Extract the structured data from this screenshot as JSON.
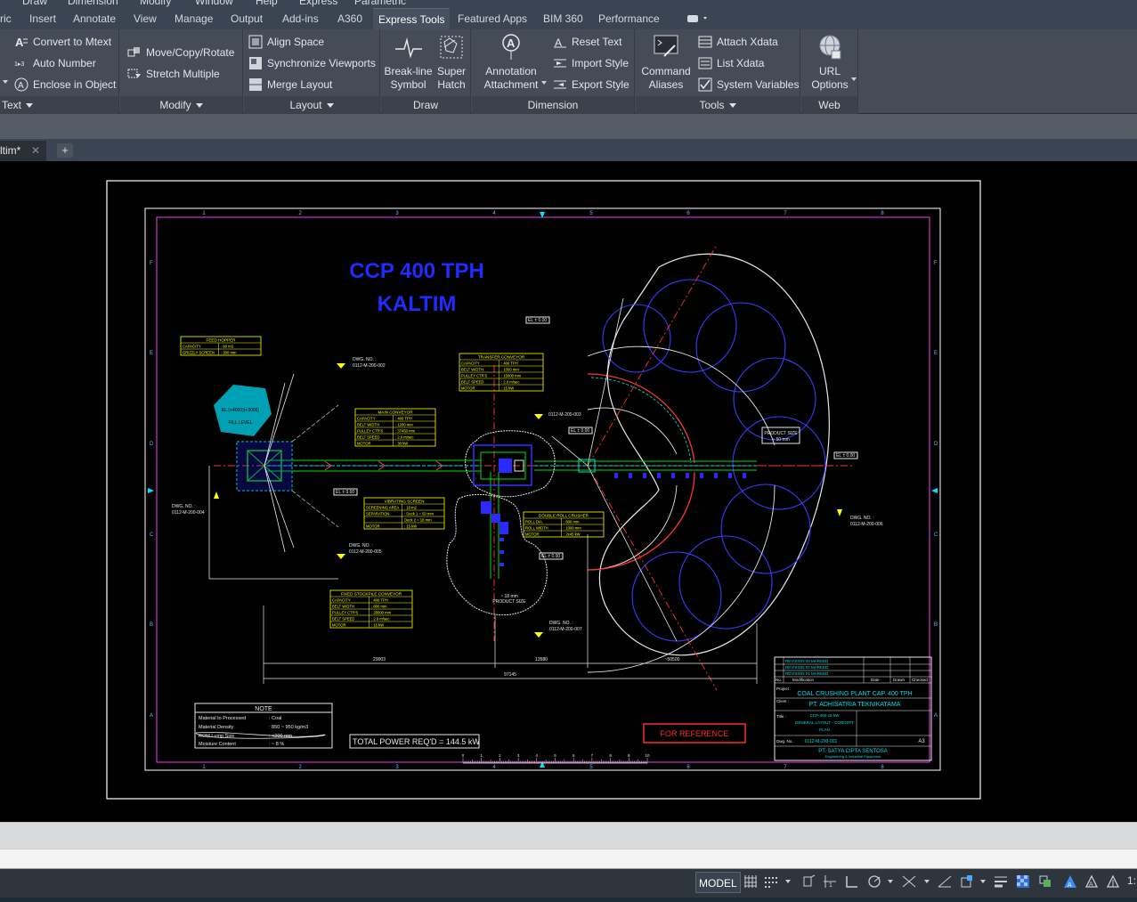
{
  "menubar": {
    "items": [
      "Draw",
      "Dimension",
      "Modify",
      "Window",
      "Help",
      "Express",
      "Parametric"
    ]
  },
  "ribbon_tabs": [
    {
      "label": "ric"
    },
    {
      "label": "Insert"
    },
    {
      "label": "Annotate"
    },
    {
      "label": "View"
    },
    {
      "label": "Manage"
    },
    {
      "label": "Output"
    },
    {
      "label": "Add-ins"
    },
    {
      "label": "A360"
    },
    {
      "label": "Express Tools",
      "active": true
    },
    {
      "label": "Featured Apps"
    },
    {
      "label": "BIM 360"
    },
    {
      "label": "Performance"
    }
  ],
  "ribbon": {
    "text_panel": {
      "title": "Text",
      "buttons": [
        "Convert to Mtext",
        "Auto Number",
        "Enclose in Object"
      ]
    },
    "modify_panel": {
      "title": "Modify",
      "buttons": [
        "Move/Copy/Rotate",
        "Stretch Multiple"
      ]
    },
    "layout_panel": {
      "title": "Layout",
      "buttons": [
        "Align Space",
        "Synchronize Viewports",
        "Merge Layout"
      ]
    },
    "draw_panel": {
      "title": "Draw",
      "large_buttons": [
        {
          "line1": "Break-line",
          "line2": "Symbol"
        },
        {
          "line1": "Super",
          "line2": "Hatch"
        }
      ]
    },
    "dimension_panel": {
      "title": "Dimension",
      "large_button": {
        "line1": "Annotation",
        "line2": "Attachment"
      },
      "buttons": [
        "Reset Text",
        "Import Style",
        "Export Style"
      ]
    },
    "tools_panel": {
      "title": "Tools",
      "large_button": {
        "line1": "Command",
        "line2": "Aliases"
      },
      "buttons": [
        "Attach Xdata",
        "List Xdata",
        "System Variables"
      ]
    },
    "web_panel": {
      "title": "Web",
      "large_button": {
        "line1": "URL",
        "line2": "Options"
      }
    }
  },
  "file_tab": {
    "label": "ltim*",
    "close": "✕",
    "plus": "+"
  },
  "drawing": {
    "title_line1": "CCP 400 TPH",
    "title_line2": "KALTIM",
    "feed_hopper": {
      "title": "FEED HOPPER",
      "rows": [
        [
          "CAPACITY",
          ": 60 m3"
        ],
        [
          "GRIZZLY SCREEN",
          ": 300 mm"
        ]
      ]
    },
    "main_conveyor": {
      "title": "MAIN CONVEYOR",
      "rows": [
        [
          "CAPACITY",
          ": 400 TPH"
        ],
        [
          "BELT WIDTH",
          ": 1200 mm"
        ],
        [
          "PULLEY CTR'S",
          ": 37450 mm"
        ],
        [
          "BELT SPEED",
          ": 2.0 m/sec"
        ],
        [
          "MOTOR",
          ": 30 kW"
        ]
      ]
    },
    "transfer_conveyor": {
      "title": "TRANSFER CONVEYOR",
      "rows": [
        [
          "CAPACITY",
          ": 400 TPH"
        ],
        [
          "BELT WIDTH",
          ": 1000 mm"
        ],
        [
          "PULLEY CTR'S",
          ": 15000 mm"
        ],
        [
          "BELT SPEED",
          ": 2.0 m/sec"
        ],
        [
          "MOTOR",
          ": 15 kW"
        ]
      ]
    },
    "vibrating_screen": {
      "title": "VIBRATING SCREEN",
      "rows": [
        [
          "SCREENING AREA",
          ": 10 m2"
        ],
        [
          "SEPARATION",
          ": Deck 1 = 50 mm"
        ],
        [
          "",
          "  Deck 2 = 18 mm"
        ],
        [
          "MOTOR",
          ": 15 kW"
        ]
      ]
    },
    "double_roll_crusher": {
      "title": "DOUBLE ROLL CRUSHER",
      "rows": [
        [
          "ROLL DIA.",
          ": 800 mm"
        ],
        [
          "ROLL WIDTH",
          ": 1000 mm"
        ],
        [
          "MOTOR",
          ": 2x45 kW"
        ]
      ]
    },
    "fixed_stockpile_conveyor": {
      "title": "FIXED STOCKPILE CONVEYOR",
      "rows": [
        [
          "CAPACITY",
          ": 400 TPH"
        ],
        [
          "BELT WIDTH",
          ": 800 mm"
        ],
        [
          "PULLEY CTR'S",
          ": 28000 mm"
        ],
        [
          "BELT SPEED",
          ": 2.0 m/sec"
        ],
        [
          "MOTOR",
          ": 15 kW"
        ]
      ]
    },
    "note": {
      "title": "NOTE",
      "rows": [
        [
          "Material to Processed",
          ":  Coal"
        ],
        [
          "Material Density",
          ":  850 ~ 950 kg/m3"
        ],
        [
          "ROM Lump Size",
          ":  <200 mm"
        ],
        [
          "Moisture Content",
          ":  ~ 8 %"
        ]
      ]
    },
    "total_power": "TOTAL POWER REQ'D = 144.5 kW",
    "for_reference": "FOR REFERENCE",
    "product_size_1": "PRODUCT SIZE",
    "product_size_1b": "~ 50 mm",
    "product_size_2": "~ 18 mm",
    "product_size_2b": "PRODUCT SIZE",
    "el_labels": [
      "EL ± 0.00",
      "EL ± 0.00",
      "EL ± 0.00",
      "EL ± 0.00",
      "EL ± 0.00"
    ],
    "fill_level": "FILL LEVEL",
    "fill_el": "EL.(+4000)(+3000)",
    "dwg_refs": [
      "DWG. NO. :",
      "0112-M-200-002",
      "0112-M-200-003",
      "0112-M-200-004",
      "0112-M-200-005",
      "0112-M-200-006",
      "0112-M-200-007"
    ],
    "dims": [
      "29003",
      "13580",
      "~50500",
      "97145"
    ],
    "grid_top": [
      "1",
      "2",
      "3",
      "4",
      "5",
      "6",
      "7",
      "8"
    ],
    "grid_side": [
      "F",
      "E",
      "D",
      "C",
      "B",
      "A"
    ],
    "scale_numbers": [
      "0",
      "1",
      "2",
      "3",
      "4",
      "5",
      "6",
      "7",
      "8",
      "9",
      "10"
    ],
    "title_block": {
      "project_label": "Project :",
      "project": "COAL CRUSHING PLANT CAP. 400 TPH",
      "client_label": "Client :",
      "client": "PT. ADHISATRIA TEKNIKATAMA",
      "title_label": "Title :",
      "title_l1": "CCP-400-16 kW",
      "title_l2": "GENERAL LAYOUT - CONCEPT",
      "title_l3": "PLAN",
      "dwg_label": "Dwg. No.",
      "dwg_no": "0112-M-200-001",
      "size": "A3",
      "company": "PT. SATYA CIPTA SENTOSA",
      "company_sub": "Engineering & Industrial Equipment",
      "rev_rows": [
        "REVISION 03 MARKED",
        "REVISION 02 MARKED",
        "REVISION 01 MARKED"
      ],
      "col_heads": [
        "No.",
        "Modification",
        "Date",
        "Drawn",
        "Checked"
      ]
    }
  },
  "statusbar": {
    "model": "MODEL",
    "right_text": "1:"
  }
}
